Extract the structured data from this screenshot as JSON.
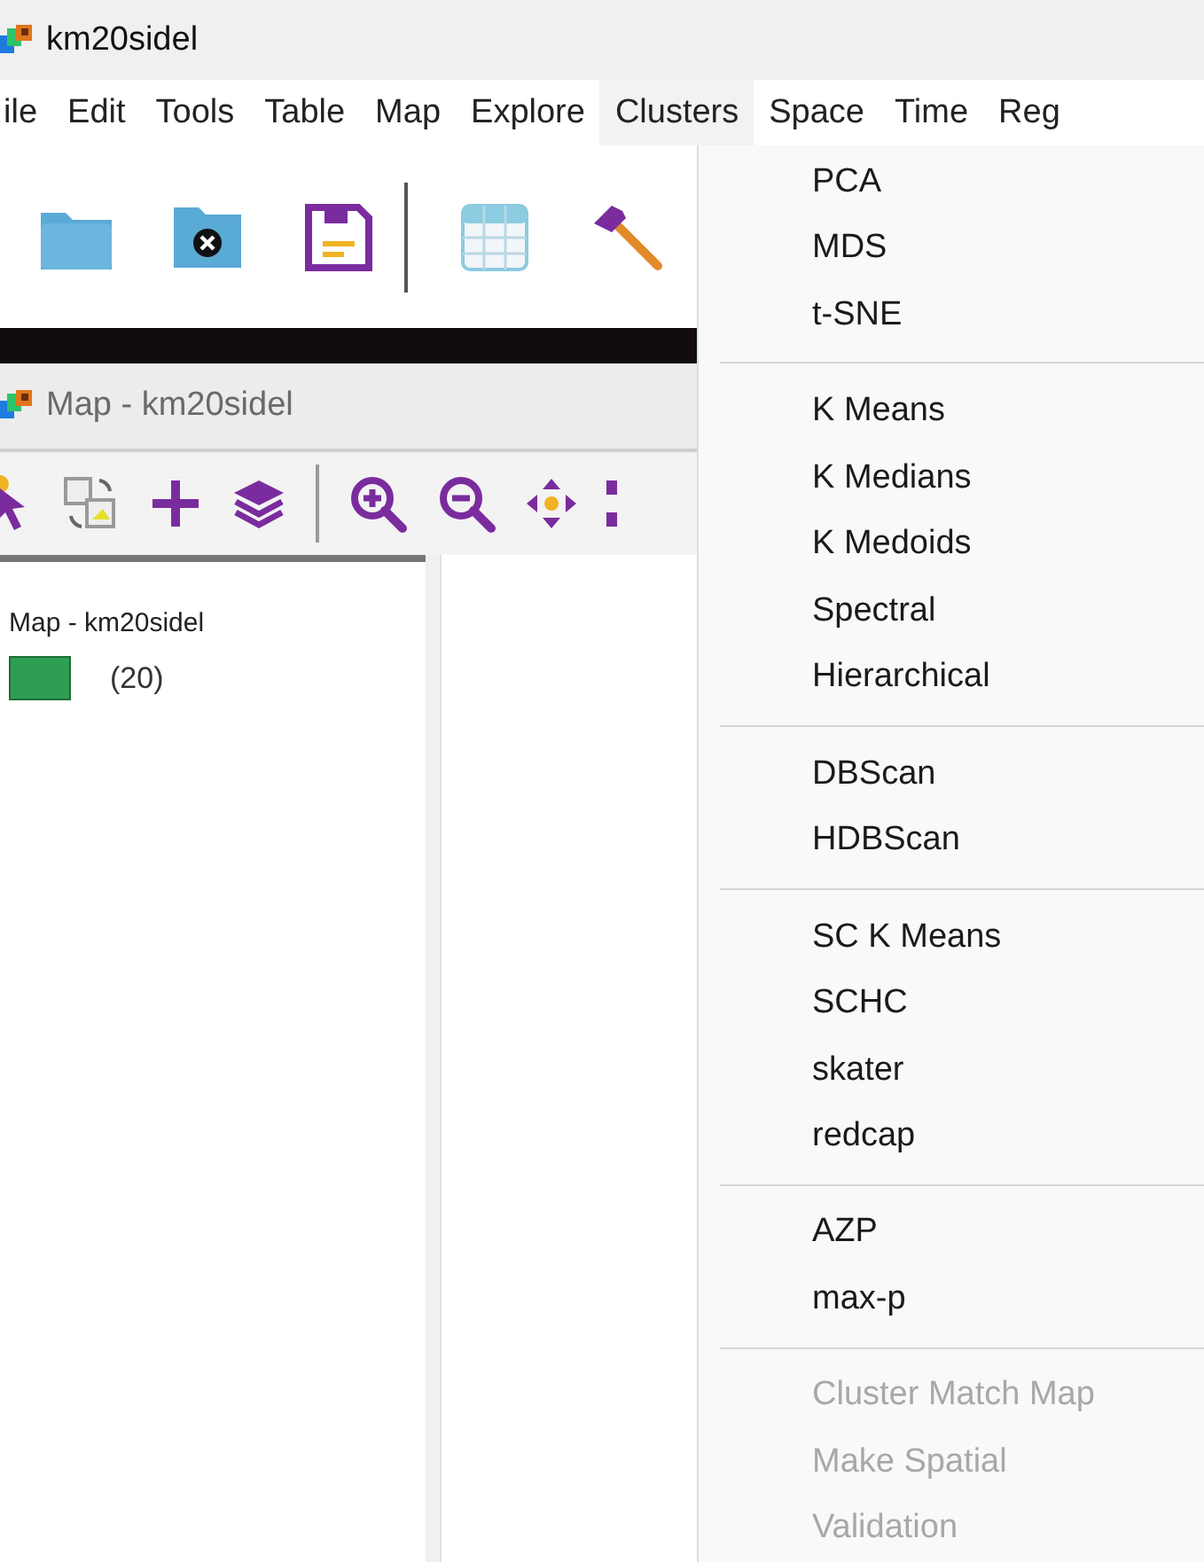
{
  "window": {
    "title": "km20sidel"
  },
  "menubar": [
    {
      "label": "ile",
      "selected": false
    },
    {
      "label": "Edit",
      "selected": false
    },
    {
      "label": "Tools",
      "selected": false
    },
    {
      "label": "Table",
      "selected": false
    },
    {
      "label": "Map",
      "selected": false
    },
    {
      "label": "Explore",
      "selected": false
    },
    {
      "label": "Clusters",
      "selected": true
    },
    {
      "label": "Space",
      "selected": false
    },
    {
      "label": "Time",
      "selected": false
    },
    {
      "label": "Reg",
      "selected": false
    }
  ],
  "map_window": {
    "title": "Map - km20sidel"
  },
  "legend": {
    "title": "Map - km20sidel",
    "categories": [
      {
        "label": "(20)",
        "color": "#2e9e52"
      }
    ]
  },
  "dropdown": {
    "groups": [
      {
        "items": [
          {
            "label": "PCA",
            "disabled": false
          },
          {
            "label": "MDS",
            "disabled": false
          },
          {
            "label": "t-SNE",
            "disabled": false
          }
        ]
      },
      {
        "items": [
          {
            "label": "K Means",
            "disabled": false
          },
          {
            "label": "K Medians",
            "disabled": false
          },
          {
            "label": "K Medoids",
            "disabled": false
          },
          {
            "label": "Spectral",
            "disabled": false
          },
          {
            "label": "Hierarchical",
            "disabled": false
          }
        ]
      },
      {
        "items": [
          {
            "label": "DBScan",
            "disabled": false
          },
          {
            "label": "HDBScan",
            "disabled": false
          }
        ]
      },
      {
        "items": [
          {
            "label": "SC K Means",
            "disabled": false
          },
          {
            "label": "SCHC",
            "disabled": false
          },
          {
            "label": "skater",
            "disabled": false
          },
          {
            "label": "redcap",
            "disabled": false
          }
        ]
      },
      {
        "items": [
          {
            "label": "AZP",
            "disabled": false
          },
          {
            "label": "max-p",
            "disabled": false
          }
        ]
      },
      {
        "items": [
          {
            "label": "Cluster Match Map",
            "disabled": true
          },
          {
            "label": "Make Spatial",
            "disabled": true
          },
          {
            "label": "Validation",
            "disabled": true
          }
        ]
      }
    ]
  }
}
